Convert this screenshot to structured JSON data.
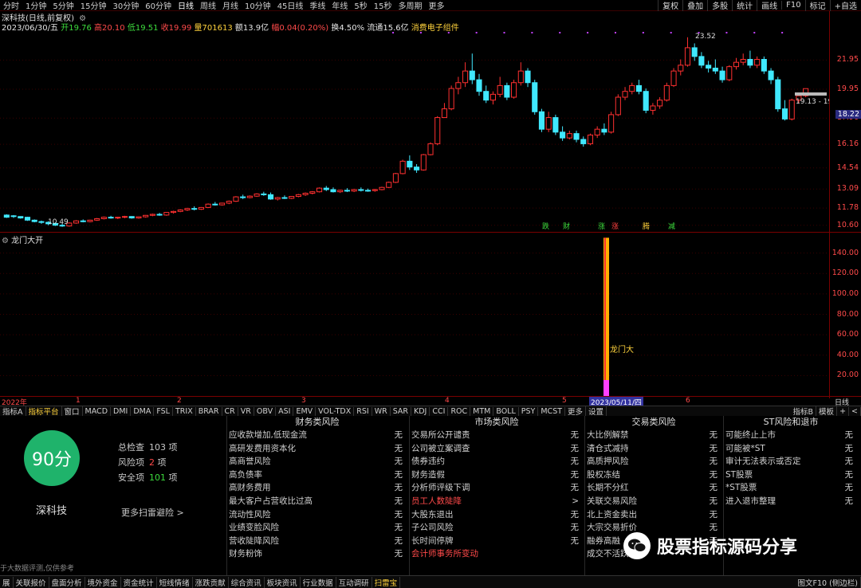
{
  "toolbar": {
    "periods": [
      "分时",
      "1分钟",
      "5分钟",
      "15分钟",
      "30分钟",
      "60分钟",
      "日线",
      "周线",
      "月线",
      "10分钟",
      "45日线",
      "季线",
      "年线",
      "5秒",
      "15秒",
      "多周期",
      "更多"
    ],
    "active_period": "日线",
    "right_buttons": [
      "复权",
      "叠加",
      "多股",
      "统计",
      "画线",
      "F10",
      "标记",
      "+自选"
    ]
  },
  "stock": {
    "title": "深科技(日线,前复权)",
    "date": "2023/06/30/五",
    "open_label": "开19.76",
    "high_label": "高20.10",
    "low_label": "低19.51",
    "close_label": "收19.99",
    "volume_label": "量701613",
    "amount_label": "额13.9亿",
    "change_label": "幅0.04(0.20%)",
    "turnover_label": "换4.50%",
    "float_label": "流通15.6亿",
    "concept_label": "消费电子组件"
  },
  "price_axis": [
    "21.95",
    "19.95",
    "17.96",
    "16.16",
    "14.54",
    "13.09",
    "11.78",
    "10.60"
  ],
  "current_price_tag": "18.22",
  "annotations": {
    "max_price": "23.52",
    "min_price": "10.49",
    "range_label": "19.13 - 19"
  },
  "signal_labels": [
    {
      "text": "跌",
      "color": "#3ddc3d"
    },
    {
      "text": "财",
      "color": "#3ddc3d"
    },
    {
      "text": "涨",
      "color": "#3ddc3d"
    },
    {
      "text": "涨",
      "color": "#ff4040"
    },
    {
      "text": "腾",
      "color": "#ffd23c"
    },
    {
      "text": "减",
      "color": "#3ddc3d"
    }
  ],
  "indicator": {
    "title": "龙门大开",
    "axis": [
      "140.00",
      "120.00",
      "100.00",
      "80.00",
      "60.00",
      "40.00",
      "20.00"
    ],
    "signal_text": "龙门大",
    "bar_value": 155
  },
  "time_axis": {
    "labels": [
      "2022年",
      "1",
      "2",
      "3",
      "4",
      "5",
      "6"
    ],
    "selected_date": "2023/05/11/四",
    "right_label": "日线"
  },
  "indicator_tabs": [
    "指标A",
    "指标平台",
    "窗口",
    "MACD",
    "DMI",
    "DMA",
    "FSL",
    "TRIX",
    "BRAR",
    "CR",
    "VR",
    "OBV",
    "ASI",
    "EMV",
    "VOL-TDX",
    "RSI",
    "WR",
    "SAR",
    "KDJ",
    "CCI",
    "ROC",
    "MTM",
    "BOLL",
    "PSY",
    "MCST",
    "更多",
    "设置"
  ],
  "indicator_tabs_active": "指标平台",
  "indicator_tabs_right": [
    "指标B",
    "模板",
    "+",
    "<"
  ],
  "risk": {
    "score": "90分",
    "stock_name": "深科技",
    "total_label": "总检查",
    "total_value": "103",
    "total_unit": "项",
    "risk_label": "风险项",
    "risk_value": "2",
    "risk_unit": "项",
    "safe_label": "安全项",
    "safe_value": "101",
    "safe_unit": "项",
    "more_link": "更多扫雷避险 >",
    "disclaimer": "于大数据评测,仅供参考",
    "columns": [
      {
        "title": "财务类风险",
        "items": [
          {
            "name": "应收款增加,低现金流",
            "status": "无"
          },
          {
            "name": "高研发费用资本化",
            "status": "无"
          },
          {
            "name": "高商誉风险",
            "status": "无"
          },
          {
            "name": "高负债率",
            "status": "无"
          },
          {
            "name": "高财务费用",
            "status": "无"
          },
          {
            "name": "最大客户占营收比过高",
            "status": "无"
          },
          {
            "name": "流动性风险",
            "status": "无"
          },
          {
            "name": "业绩变脸风险",
            "status": "无"
          },
          {
            "name": "营收陡降风险",
            "status": "无"
          },
          {
            "name": "财务粉饰",
            "status": "无"
          }
        ]
      },
      {
        "title": "市场类风险",
        "items": [
          {
            "name": "交易所公开谴责",
            "status": "无"
          },
          {
            "name": "公司被立案调查",
            "status": "无"
          },
          {
            "name": "债券违约",
            "status": "无"
          },
          {
            "name": "财务造假",
            "status": "无"
          },
          {
            "name": "分析师评级下调",
            "status": "无"
          },
          {
            "name": "员工人数陡降",
            "status": ">",
            "warn": true
          },
          {
            "name": "大股东退出",
            "status": "无"
          },
          {
            "name": "子公司风险",
            "status": "无"
          },
          {
            "name": "长时间停牌",
            "status": "无"
          },
          {
            "name": "会计师事务所变动",
            "status": "",
            "warn": true
          }
        ]
      },
      {
        "title": "交易类风险",
        "items": [
          {
            "name": "大比例解禁",
            "status": "无"
          },
          {
            "name": "清仓式减持",
            "status": "无"
          },
          {
            "name": "高质押风险",
            "status": "无"
          },
          {
            "name": "股权冻结",
            "status": "无"
          },
          {
            "name": "长期不分红",
            "status": "无"
          },
          {
            "name": "关联交易风险",
            "status": "无"
          },
          {
            "name": "北上资金卖出",
            "status": "无"
          },
          {
            "name": "大宗交易折价",
            "status": "无"
          },
          {
            "name": "融券高融",
            "status": "无"
          },
          {
            "name": "成交不活跃",
            "status": ""
          }
        ]
      },
      {
        "title": "ST风险和退市",
        "items": [
          {
            "name": "可能终止上市",
            "status": "无"
          },
          {
            "name": "可能被*ST",
            "status": "无"
          },
          {
            "name": "审计无法表示或否定",
            "status": "无"
          },
          {
            "name": "ST股票",
            "status": "无"
          },
          {
            "name": "*ST股票",
            "status": "无"
          },
          {
            "name": "进入退市整理",
            "status": "无"
          }
        ]
      }
    ]
  },
  "bottom_tabs": [
    "展",
    "关联报价",
    "盘面分析",
    "境外资金",
    "资金统计",
    "短线情绪",
    "涨跌贡献",
    "综合资讯",
    "板块资讯",
    "行业数据",
    "互动调研",
    "扫雷宝"
  ],
  "bottom_tabs_active": "扫雷宝",
  "bottom_right": "图文F10 (侧边栏)",
  "watermark": "股票指标源码分享",
  "chart_data": {
    "type": "candlestick",
    "price_range": [
      10.2,
      24.0
    ],
    "candles": [
      [
        11.3,
        11.35,
        11.15,
        11.1
      ],
      [
        11.25,
        11.3,
        11.2,
        11.1
      ],
      [
        11.2,
        11.22,
        11.1,
        11.05
      ],
      [
        11.15,
        11.18,
        10.95,
        10.9
      ],
      [
        10.95,
        11.0,
        10.85,
        10.8
      ],
      [
        10.85,
        10.92,
        10.8,
        10.7
      ],
      [
        10.8,
        10.88,
        10.7,
        10.6
      ],
      [
        10.72,
        10.8,
        10.6,
        10.55
      ],
      [
        10.6,
        10.7,
        10.55,
        10.49
      ],
      [
        10.55,
        10.8,
        10.75,
        10.5
      ],
      [
        10.75,
        10.95,
        10.9,
        10.7
      ],
      [
        10.9,
        11.0,
        10.85,
        10.8
      ],
      [
        10.85,
        10.98,
        10.95,
        10.8
      ],
      [
        10.95,
        11.1,
        11.05,
        10.9
      ],
      [
        11.05,
        11.2,
        11.15,
        11.0
      ],
      [
        11.15,
        11.25,
        11.1,
        11.05
      ],
      [
        11.1,
        11.18,
        11.15,
        11.02
      ],
      [
        11.15,
        11.25,
        11.2,
        11.08
      ],
      [
        11.2,
        11.22,
        11.1,
        11.05
      ],
      [
        11.1,
        11.2,
        11.18,
        11.05
      ],
      [
        11.18,
        11.3,
        11.28,
        11.12
      ],
      [
        11.28,
        11.4,
        11.35,
        11.22
      ],
      [
        11.35,
        11.45,
        11.3,
        11.25
      ],
      [
        11.3,
        11.5,
        11.48,
        11.25
      ],
      [
        11.48,
        11.6,
        11.55,
        11.4
      ],
      [
        11.55,
        11.7,
        11.65,
        11.5
      ],
      [
        11.65,
        11.8,
        11.75,
        11.58
      ],
      [
        11.75,
        11.9,
        11.7,
        11.62
      ],
      [
        11.7,
        11.85,
        11.82,
        11.65
      ],
      [
        11.82,
        12.1,
        12.05,
        11.78
      ],
      [
        12.05,
        12.2,
        12.0,
        11.95
      ],
      [
        12.0,
        12.15,
        12.12,
        11.95
      ],
      [
        12.12,
        12.3,
        12.25,
        12.05
      ],
      [
        12.25,
        12.6,
        12.55,
        12.2
      ],
      [
        12.55,
        12.7,
        12.5,
        12.4
      ],
      [
        12.5,
        12.65,
        12.6,
        12.45
      ],
      [
        12.6,
        12.8,
        12.75,
        12.55
      ],
      [
        12.75,
        12.9,
        12.7,
        12.62
      ],
      [
        12.7,
        12.85,
        12.4,
        12.35
      ],
      [
        12.4,
        12.55,
        12.5,
        12.3
      ],
      [
        12.5,
        12.65,
        12.45,
        12.4
      ],
      [
        12.45,
        12.6,
        12.58,
        12.4
      ],
      [
        12.58,
        12.75,
        12.7,
        12.52
      ],
      [
        12.7,
        12.85,
        12.8,
        12.62
      ],
      [
        12.8,
        12.95,
        12.9,
        12.72
      ],
      [
        12.9,
        13.2,
        13.15,
        12.85
      ],
      [
        13.15,
        13.3,
        13.05,
        12.95
      ],
      [
        13.05,
        13.2,
        12.9,
        12.85
      ],
      [
        12.9,
        13.05,
        13.0,
        12.82
      ],
      [
        13.0,
        13.15,
        12.95,
        12.88
      ],
      [
        12.95,
        13.1,
        13.05,
        12.88
      ],
      [
        13.05,
        13.2,
        13.0,
        12.92
      ],
      [
        13.0,
        13.12,
        12.98,
        12.9
      ],
      [
        12.98,
        13.1,
        13.05,
        12.9
      ],
      [
        13.05,
        13.25,
        13.2,
        13.0
      ],
      [
        13.2,
        13.6,
        13.55,
        13.15
      ],
      [
        13.55,
        14.2,
        14.15,
        13.5
      ],
      [
        14.15,
        15.1,
        15.0,
        14.1
      ],
      [
        15.0,
        15.4,
        14.6,
        14.4
      ],
      [
        14.6,
        14.8,
        14.4,
        14.2
      ],
      [
        14.4,
        15.5,
        15.45,
        14.35
      ],
      [
        15.45,
        16.3,
        16.2,
        15.4
      ],
      [
        16.2,
        18.1,
        18.0,
        16.1
      ],
      [
        18.0,
        19.0,
        18.6,
        18.4
      ],
      [
        18.6,
        20.2,
        20.0,
        18.5
      ],
      [
        20.0,
        20.8,
        20.4,
        19.6
      ],
      [
        20.4,
        21.8,
        21.2,
        20.1
      ],
      [
        21.2,
        22.4,
        20.6,
        20.3
      ],
      [
        20.6,
        21.0,
        19.8,
        19.5
      ],
      [
        19.8,
        20.2,
        19.2,
        19.0
      ],
      [
        19.2,
        19.8,
        19.6,
        18.9
      ],
      [
        19.6,
        20.8,
        20.2,
        19.4
      ],
      [
        20.2,
        20.4,
        19.4,
        19.2
      ],
      [
        19.4,
        20.6,
        20.4,
        19.3
      ],
      [
        20.4,
        21.8,
        21.2,
        20.2
      ],
      [
        21.2,
        21.4,
        20.4,
        20.1
      ],
      [
        20.4,
        20.6,
        18.4,
        18.2
      ],
      [
        18.4,
        18.6,
        17.2,
        17.0
      ],
      [
        17.2,
        18.4,
        18.0,
        17.0
      ],
      [
        18.0,
        18.2,
        17.0,
        16.8
      ],
      [
        17.0,
        17.4,
        16.6,
        16.4
      ],
      [
        16.6,
        17.1,
        16.9,
        16.5
      ],
      [
        16.9,
        17.1,
        16.5,
        16.3
      ],
      [
        16.5,
        16.7,
        16.2,
        16.0
      ],
      [
        16.2,
        16.9,
        16.8,
        16.1
      ],
      [
        16.8,
        17.4,
        17.2,
        16.6
      ],
      [
        17.2,
        17.6,
        17.0,
        16.8
      ],
      [
        17.0,
        18.4,
        18.2,
        16.9
      ],
      [
        18.2,
        19.6,
        19.4,
        18.1
      ],
      [
        19.4,
        20.1,
        19.8,
        19.2
      ],
      [
        19.8,
        20.4,
        20.2,
        19.6
      ],
      [
        20.2,
        20.6,
        19.8,
        19.6
      ],
      [
        19.8,
        20.0,
        18.5,
        18.3
      ],
      [
        18.5,
        19.0,
        18.8,
        18.2
      ],
      [
        18.8,
        19.4,
        19.2,
        18.6
      ],
      [
        19.2,
        20.4,
        20.2,
        19.1
      ],
      [
        20.2,
        21.4,
        21.2,
        20.1
      ],
      [
        21.2,
        22.0,
        21.6,
        20.9
      ],
      [
        21.6,
        23.52,
        22.8,
        21.5
      ],
      [
        22.8,
        23.1,
        22.2,
        21.9
      ],
      [
        22.2,
        22.5,
        21.6,
        21.4
      ],
      [
        21.6,
        21.9,
        21.4,
        21.1
      ],
      [
        21.4,
        22.0,
        21.2,
        21.0
      ],
      [
        21.2,
        21.5,
        20.6,
        20.4
      ],
      [
        20.6,
        21.6,
        21.5,
        20.5
      ],
      [
        21.5,
        22.1,
        21.8,
        21.3
      ],
      [
        21.8,
        22.4,
        22.0,
        21.6
      ],
      [
        22.0,
        22.6,
        21.6,
        21.4
      ],
      [
        21.6,
        22.2,
        22.0,
        21.4
      ],
      [
        22.0,
        22.2,
        21.2,
        21.0
      ],
      [
        21.2,
        21.4,
        20.6,
        20.3
      ],
      [
        20.6,
        20.8,
        18.6,
        18.4
      ],
      [
        18.6,
        19.2,
        17.9,
        17.8
      ],
      [
        17.9,
        19.3,
        19.2,
        17.8
      ],
      [
        19.2,
        19.6,
        19.5,
        19.0
      ],
      [
        19.5,
        19.8,
        19.99,
        19.4
      ]
    ]
  }
}
